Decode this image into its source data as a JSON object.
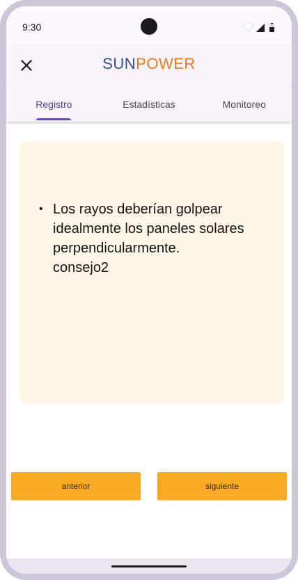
{
  "status_bar": {
    "time": "9:30",
    "icons": [
      "wifi-icon",
      "signal-icon",
      "battery-icon"
    ]
  },
  "app_bar": {
    "close_icon": "close-icon",
    "brand_part1": "SUN",
    "brand_part2": "POWER",
    "brand_colors": {
      "sun": "#2c4f9c",
      "power": "#ee7a1a"
    }
  },
  "tabs": [
    {
      "label": "Registro",
      "active": true
    },
    {
      "label": "Estadísticas",
      "active": false
    },
    {
      "label": "Monitoreo",
      "active": false
    }
  ],
  "tip": {
    "bullet": "•",
    "text": "Los rayos deberían golpear idealmente los paneles solares perpendicularmente.\nconsejo2"
  },
  "buttons": {
    "previous": "anterior",
    "next": "siguiente",
    "color": "#f8ab22"
  },
  "colors": {
    "accent": "#6750a4",
    "card_background": "#fef6e9"
  }
}
